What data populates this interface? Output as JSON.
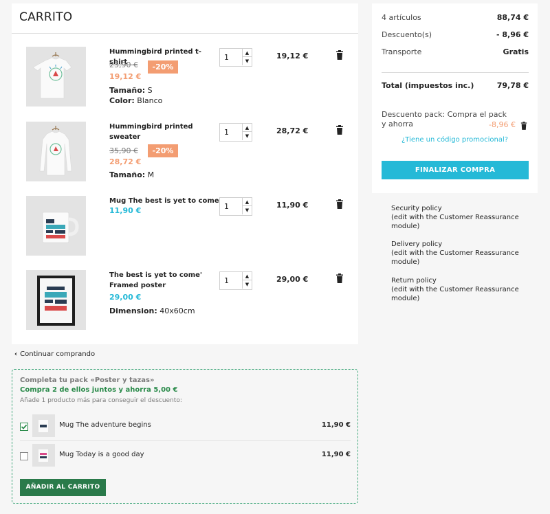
{
  "cart": {
    "title": "CARRITO",
    "items": [
      {
        "name": "Hummingbird printed t-shirt",
        "old_price": "23,90 €",
        "discount": "-20%",
        "price": "19,12 €",
        "attrs": [
          {
            "label": "Tamaño:",
            "value": " S"
          },
          {
            "label": "Color:",
            "value": " Blanco"
          }
        ],
        "qty": "1",
        "total": "19,12 €"
      },
      {
        "name": "Hummingbird printed sweater",
        "old_price": "35,90 €",
        "discount": "-20%",
        "price": "28,72 €",
        "attrs": [
          {
            "label": "Tamaño:",
            "value": " M"
          }
        ],
        "qty": "1",
        "total": "28,72 €"
      },
      {
        "name": "Mug The best is yet to come",
        "price": "11,90 €",
        "qty": "1",
        "total": "11,90 €"
      },
      {
        "name": "The best is yet to come' Framed poster",
        "price": "29,00 €",
        "attrs": [
          {
            "label": "Dimension:",
            "value": " 40x60cm"
          }
        ],
        "qty": "1",
        "total": "29,00 €"
      }
    ]
  },
  "continue_label": "Continuar comprando",
  "pack": {
    "title": "Completa tu pack «Poster y tazas»",
    "subtitle": "Compra 2 de ellos juntos y ahorra 5,00 €",
    "hint": "Añade 1 producto más para conseguir el descuento:",
    "products": [
      {
        "name": "Mug The adventure begins",
        "price": "11,90 €",
        "checked": true
      },
      {
        "name": "Mug Today is a good day",
        "price": "11,90 €",
        "checked": false
      }
    ],
    "add_button": "AÑADIR AL CARRITO"
  },
  "summary": {
    "items_label": "4 artículos",
    "items_value": "88,74 €",
    "discount_label": "Descuento(s)",
    "discount_value": "- 8,96 €",
    "shipping_label": "Transporte",
    "shipping_value": "Gratis",
    "total_label": "Total (impuestos inc.)",
    "total_value": "79,78 €",
    "pack_discount_label": "Descuento pack: Compra el pack y ahorra",
    "pack_discount_value": "-8,96 €",
    "promo_link": "¿Tiene un código promocional?",
    "checkout_button": "FINALIZAR COMPRA"
  },
  "reassurance": [
    {
      "title": "Security policy",
      "desc": "(edit with the Customer Reassurance module)"
    },
    {
      "title": "Delivery policy",
      "desc": "(edit with the Customer Reassurance module)"
    },
    {
      "title": "Return policy",
      "desc": "(edit with the Customer Reassurance module)"
    }
  ],
  "colors": {
    "accent_blue": "#25b9d7",
    "discount_orange": "#f39d72",
    "pack_green": "#2a7a4a"
  }
}
